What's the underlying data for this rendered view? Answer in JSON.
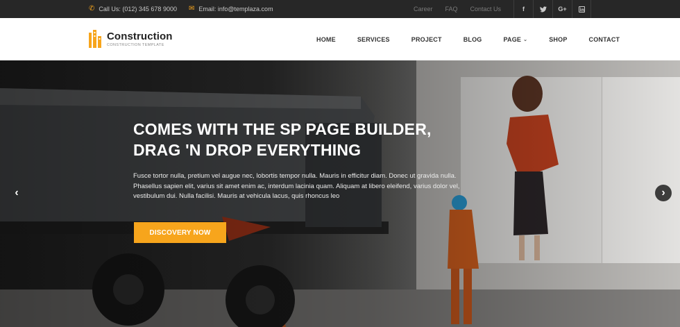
{
  "topbar": {
    "phone": "Call Us: (012) 345 678 9000",
    "email": "Email: info@templaza.com",
    "links": [
      "Career",
      "FAQ",
      "Contact Us"
    ],
    "social": [
      {
        "icon": "facebook-icon",
        "glyph": "f"
      },
      {
        "icon": "twitter-icon",
        "glyph": "t"
      },
      {
        "icon": "google-plus-icon",
        "glyph": "G+"
      },
      {
        "icon": "linkedin-icon",
        "glyph": "in"
      }
    ]
  },
  "header": {
    "logo_title": "Construction",
    "logo_subtitle": "CONSTRUCTION TEMPLATE",
    "nav": [
      "HOME",
      "SERVICES",
      "PROJECT",
      "BLOG",
      "PAGE",
      "SHOP",
      "CONTACT"
    ]
  },
  "hero": {
    "headline_line1": "COMES WITH THE SP PAGE BUILDER,",
    "headline_line2": "DRAG 'N DROP EVERYTHING",
    "paragraph": "Fusce tortor nulla, pretium vel augue nec, lobortis tempor nulla. Mauris in efficitur diam. Donec ut gravida nulla. Phasellus sapien elit, varius sit amet enim ac, interdum lacinia quam. Aliquam at libero eleifend, varius dolor vel, vestibulum dui. Nulla facilisi. Mauris at vehicula lacus, quis rhoncus leo",
    "cta": "DISCOVERY NOW",
    "prev_glyph": "‹",
    "next_glyph": "›"
  },
  "colors": {
    "accent": "#f7a51c",
    "topbar_bg": "#272727"
  }
}
